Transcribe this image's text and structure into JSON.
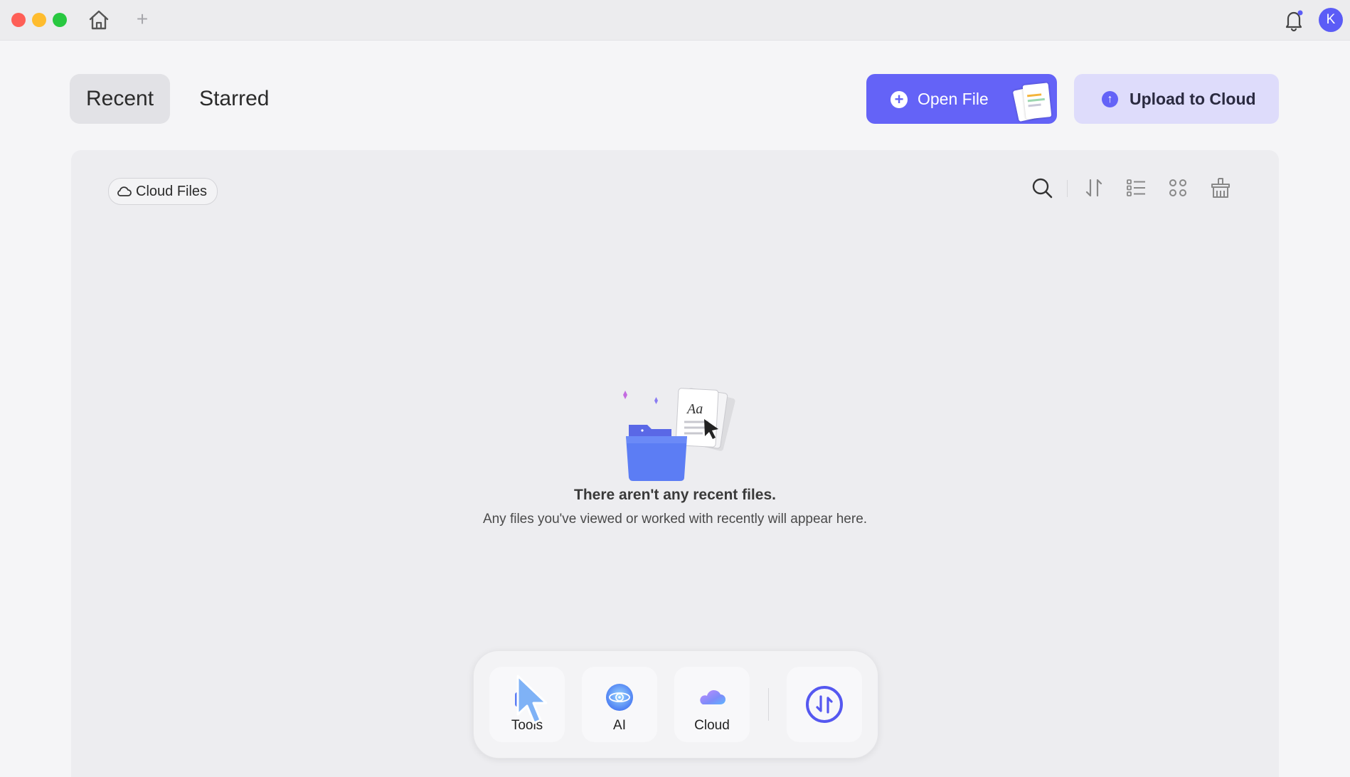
{
  "titlebar": {
    "avatar_initial": "K",
    "new_tab_symbol": "+",
    "icons": [
      "home-icon",
      "plus-icon",
      "bell-icon"
    ]
  },
  "tabs": [
    {
      "label": "Recent",
      "active": true
    },
    {
      "label": "Starred",
      "active": false
    }
  ],
  "actions": {
    "open_file_label": "Open File",
    "upload_label": "Upload to Cloud",
    "accent_color": "#6463f7",
    "upload_bg_color": "#dedcfb"
  },
  "panel": {
    "cloud_files_label": "Cloud Files",
    "toolbar_icons": [
      "search-icon",
      "sort-icon",
      "list-view-icon",
      "grid-view-icon",
      "clean-icon"
    ]
  },
  "empty_state": {
    "title": "There aren't any recent files.",
    "subtitle": "Any files you've viewed or worked with recently will appear here.",
    "illustration_text": "Aa"
  },
  "dock": {
    "items": [
      {
        "label": "Tools",
        "icon": "tools-icon"
      },
      {
        "label": "AI",
        "icon": "ai-icon"
      },
      {
        "label": "Cloud",
        "icon": "cloud-icon"
      }
    ],
    "extra_icon": "convert-icon"
  }
}
